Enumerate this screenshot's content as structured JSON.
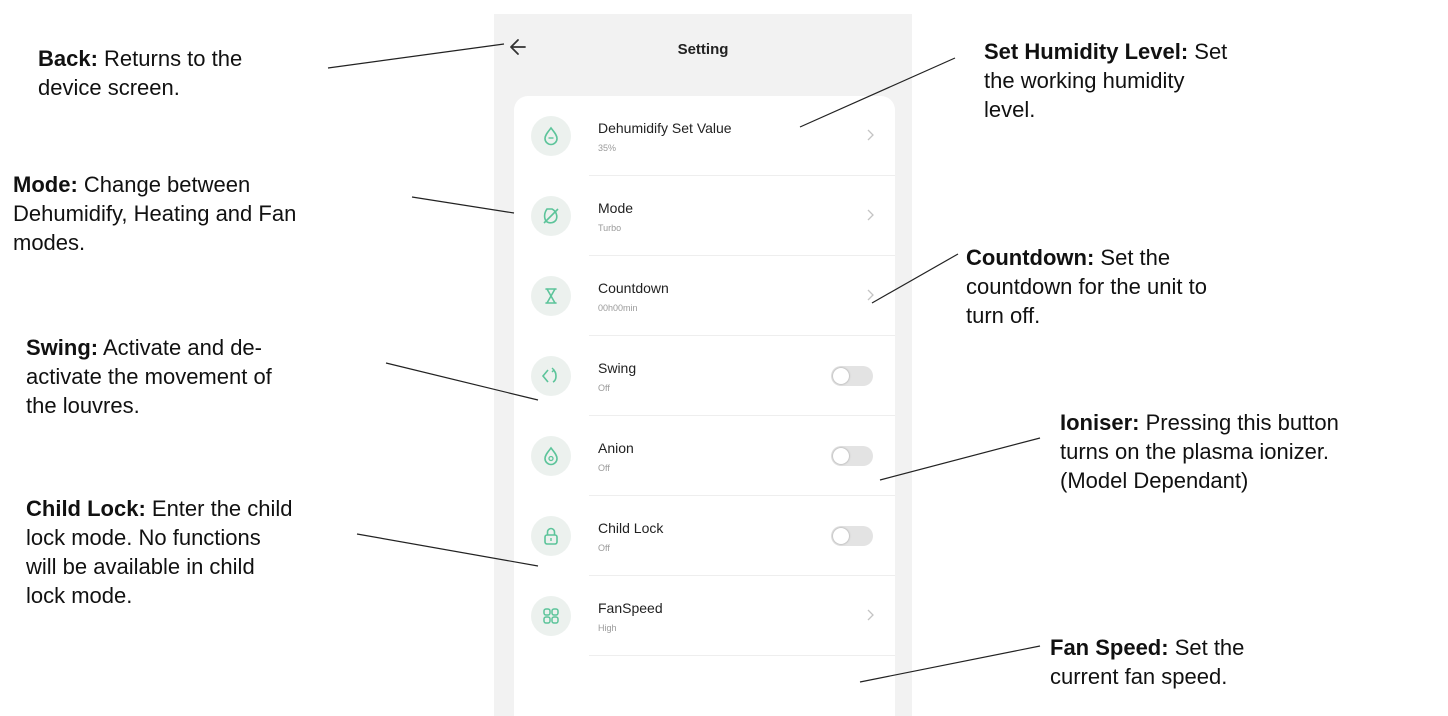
{
  "app": {
    "title": "Setting"
  },
  "colors": {
    "accent": "#5cc49a",
    "icon_bg": "#ecf1ee",
    "panel_bg": "#f2f2f2"
  },
  "settings": [
    {
      "label": "Dehumidify Set Value",
      "value": "35%",
      "control": "chevron",
      "icon": "droplet-icon"
    },
    {
      "label": "Mode",
      "value": "Turbo",
      "control": "chevron",
      "icon": "mode-icon"
    },
    {
      "label": "Countdown",
      "value": "00h00min",
      "control": "chevron",
      "icon": "hourglass-icon"
    },
    {
      "label": "Swing",
      "value": "Off",
      "control": "toggle",
      "state": "off",
      "icon": "swing-icon"
    },
    {
      "label": "Anion",
      "value": "Off",
      "control": "toggle",
      "state": "off",
      "icon": "anion-icon"
    },
    {
      "label": "Child Lock",
      "value": "Off",
      "control": "toggle",
      "state": "off",
      "icon": "lock-icon"
    },
    {
      "label": "FanSpeed",
      "value": "High",
      "control": "chevron",
      "icon": "fan-grid-icon"
    }
  ],
  "annotations": {
    "back": {
      "title": "Back:",
      "lines": [
        " Returns to the",
        "device screen."
      ]
    },
    "mode": {
      "title": "Mode:",
      "lines": [
        " Change between",
        "Dehumidify, Heating and Fan",
        "modes."
      ]
    },
    "swing": {
      "title": "Swing:",
      "lines": [
        " Activate and de-",
        "activate the movement of",
        "the louvres."
      ]
    },
    "child_lock": {
      "title": "Child Lock:",
      "lines": [
        " Enter the child",
        "lock mode. No functions",
        "will be available in child",
        "lock mode."
      ]
    },
    "set_humidity": {
      "title": "Set Humidity Level:",
      "lines": [
        " Set",
        "the working humidity",
        "level."
      ]
    },
    "countdown": {
      "title": "Countdown:",
      "lines": [
        " Set the",
        "countdown for the unit to",
        "turn off."
      ]
    },
    "ioniser": {
      "title": "Ioniser:",
      "lines": [
        " Pressing this button",
        "turns on the plasma ionizer.",
        "(Model Dependant)"
      ]
    },
    "fan_speed": {
      "title": "Fan Speed:",
      "lines": [
        " Set the",
        "current fan speed."
      ]
    }
  }
}
